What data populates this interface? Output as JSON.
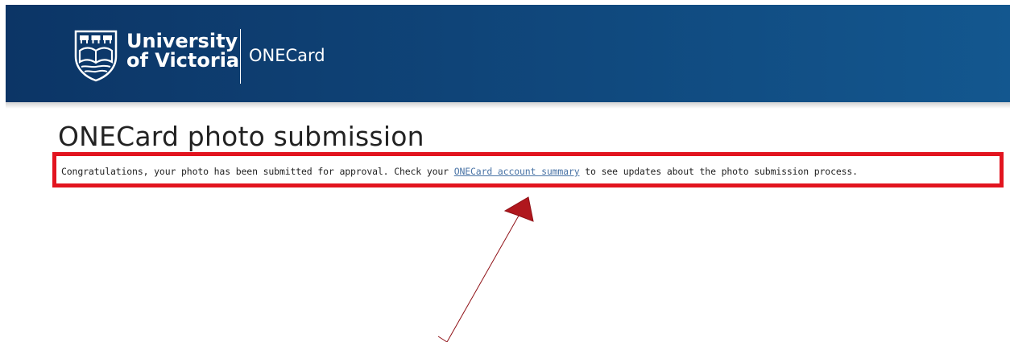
{
  "header": {
    "university_line1": "University",
    "university_line2": "of Victoria",
    "app_name": "ONECard",
    "crest_icon": "uvic-crest-icon"
  },
  "main": {
    "title": "ONECard photo submission",
    "message_before": "Congratulations, your photo has been submitted for approval. Check your ",
    "link_text": "ONECard account summary",
    "message_after": " to see updates about the photo submission process."
  },
  "annotation": {
    "box_color": "#e2141f",
    "arrow_color": "#b0171d"
  }
}
